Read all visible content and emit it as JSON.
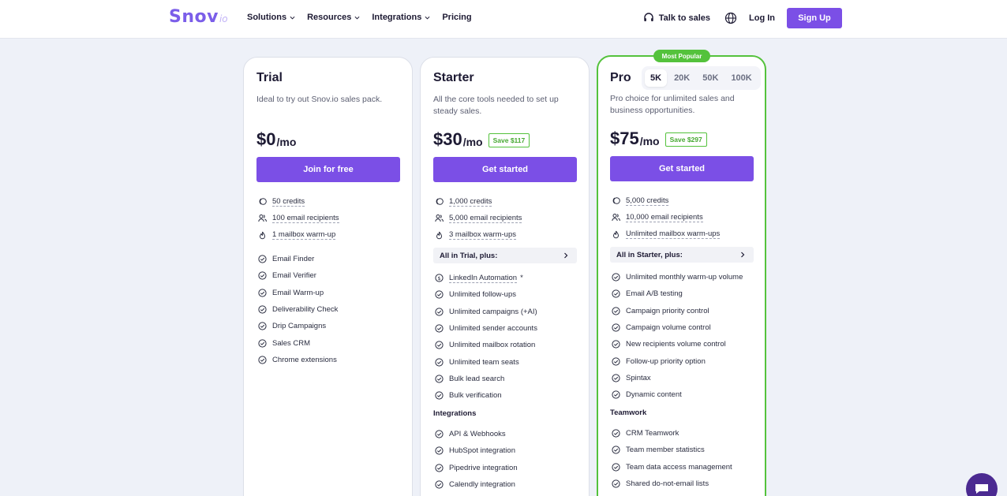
{
  "nav": {
    "logo_main": "Snov",
    "logo_suffix": "io",
    "menu": [
      "Solutions",
      "Resources",
      "Integrations"
    ],
    "pricing": "Pricing",
    "talk": "Talk to sales",
    "login": "Log In",
    "signup": "Sign Up"
  },
  "trial": {
    "name": "Trial",
    "desc": "Ideal to try out Snov.io sales pack.",
    "price": "$0",
    "per": "/mo",
    "cta": "Join for free",
    "credits": [
      "50 credits",
      "100 email recipients",
      "1 mailbox warm-up"
    ],
    "features": [
      "Email Finder",
      "Email Verifier",
      "Email Warm-up",
      "Deliverability Check",
      "Drip Campaigns",
      "Sales CRM",
      "Chrome extensions"
    ]
  },
  "starter": {
    "name": "Starter",
    "desc": "All the core tools needed to set up steady sales.",
    "price": "$30",
    "per": "/mo",
    "save": "Save $117",
    "cta": "Get started",
    "credits": [
      "1,000 credits",
      "5,000 email recipients",
      "3 mailbox warm-ups"
    ],
    "plus": "All in Trial, plus:",
    "linkedin": "LinkedIn Automation",
    "linkedin_mark": "*",
    "features": [
      "Unlimited follow-ups",
      "Unlimited campaigns (+AI)",
      "Unlimited sender accounts",
      "Unlimited mailbox rotation",
      "Unlimited team seats",
      "Bulk lead search",
      "Bulk verification"
    ],
    "section": "Integrations",
    "section_items": [
      "API & Webhooks",
      "HubSpot integration",
      "Pipedrive integration",
      "Calendly integration"
    ]
  },
  "pro": {
    "badge": "Most Popular",
    "name": "Pro",
    "tiers": [
      "5K",
      "20K",
      "50K",
      "100K"
    ],
    "active_tier": "5K",
    "desc": "Pro choice for unlimited sales and business opportunities.",
    "price": "$75",
    "per": "/mo",
    "save": "Save $297",
    "cta": "Get started",
    "credits": [
      "5,000 credits",
      "10,000 email recipients",
      "Unlimited mailbox warm-ups"
    ],
    "plus": "All in Starter, plus:",
    "features": [
      "Unlimited monthly warm-up volume",
      "Email A/B testing",
      "Campaign priority control",
      "Campaign volume control",
      "New recipients volume control",
      "Follow-up priority option",
      "Spintax",
      "Dynamic content"
    ],
    "section": "Teamwork",
    "section_items": [
      "CRM Teamwork",
      "Team member statistics",
      "Team data access management",
      "Shared do-not-email lists"
    ]
  },
  "colors": {
    "accent": "#7b4fe6",
    "popular": "#54c23c",
    "chat": "#4b2a91"
  }
}
